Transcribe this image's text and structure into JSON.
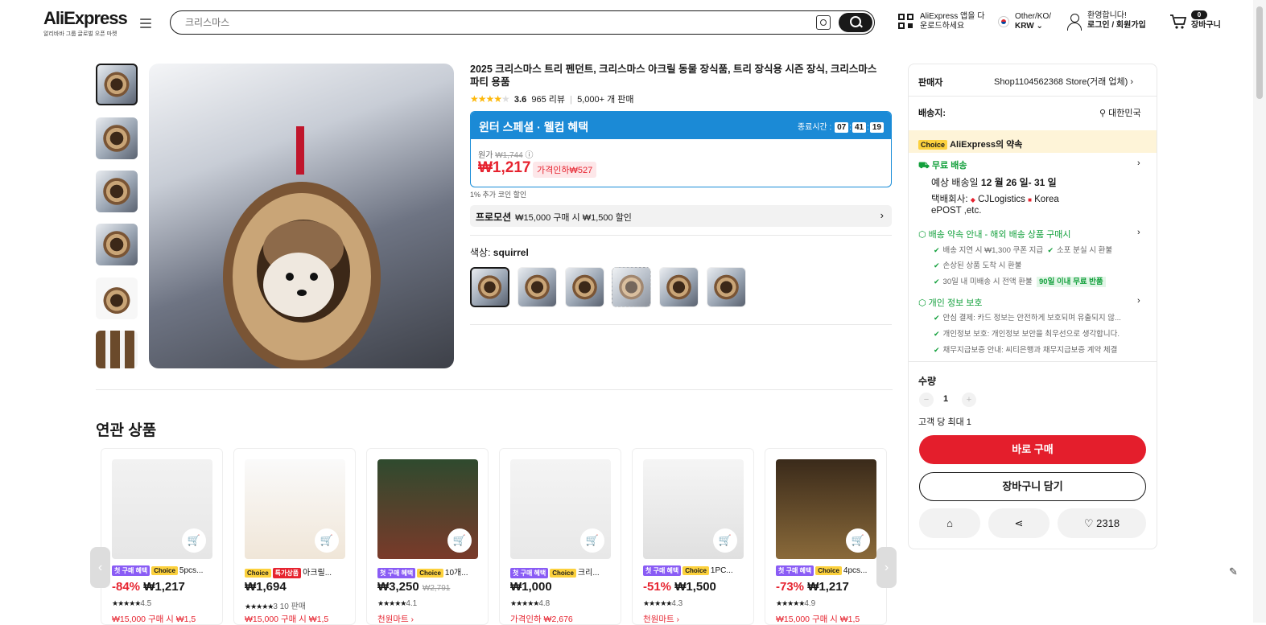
{
  "header": {
    "logo": "AliExpress",
    "logo_sub": "알리바바 그룹 글로벌 오픈 마켓",
    "search_placeholder": "크리스마스",
    "app_download": [
      "AliExpress 앱을 다",
      "운로드하세요"
    ],
    "region_top": "Other/KO/",
    "region_currency": "KRW",
    "welcome": "환영합니다!",
    "login": "로그인 / 회원가입",
    "cart_count": "0",
    "cart_label": "장바구니"
  },
  "product": {
    "title": "2025 크리스마스 트리 펜던트, 크리스마스 아크릴 동물 장식품, 트리 장식용 시즌 장식, 크리스마스 파티 용품",
    "rating": "3.6",
    "reviews": "965 리뷰",
    "sold": "5,000+ 개 판매",
    "promo_title": "윈터 스페셜 · 웰컴 혜택",
    "timer_label": "종료시간 :",
    "timer": [
      "07",
      "41",
      "19"
    ],
    "original_label": "원가",
    "original_price": "₩1,744",
    "price": "₩1,217",
    "discount": "가격인하₩527",
    "coin_note": "1% 추가 코인 할인",
    "promotion_label": "프로모션",
    "promotion_text": "₩15,000 구매 시 ₩1,500 할인",
    "color_label": "색상:",
    "color_value": "squirrel"
  },
  "seller": {
    "seller_label": "판매자",
    "seller_name": "Shop1104562368 Store(거래 업체)",
    "ship_label": "배송지:",
    "ship_to": "대한민국",
    "choice_tag": "Choice",
    "choice_promise": "AliExpress의 약속",
    "free_ship": "무료 배송",
    "eta_label": "예상 배송일",
    "eta": "12 월 26 일- 31 일",
    "courier_label": "택배회사:",
    "courier_1": "CJLogistics",
    "courier_2": "Korea",
    "courier_3": "ePOST ,etc.",
    "promise_title": "배송 약속 안내 - 해외 배송 상품 구매시",
    "promise_items": [
      "배송 지연 시 ₩1,300 쿠폰 지급",
      "소포 분실 시 환불",
      "손상된 상품 도착 시 환불",
      "30일 내 미배송 시 전액 환불"
    ],
    "promise_badge": "90일 이내 무료 반품",
    "privacy_title": "개인 정보 보호",
    "privacy_items": [
      "안심 결제: 카드 정보는 안전하게 보호되며 유출되지 않...",
      "개인정보 보호: 개인정보 보안을 최우선으로 생각합니다.",
      "채무지급보증 안내: 씨티은행과 채무지급보증 계약 체결"
    ],
    "qty_label": "수량",
    "qty": "1",
    "limit": "고객 당 최대 1",
    "buy_now": "바로 구매",
    "add_cart": "장바구니 담기",
    "wishlist_count": "2318"
  },
  "related": {
    "heading": "연관 상품",
    "items": [
      {
        "tags": [
          "첫 구매 혜택",
          "Choice"
        ],
        "name": "5pcs...",
        "pct": "-84%",
        "price": "₩1,217",
        "old": "",
        "rating": "4.5",
        "sold": "",
        "extra": "₩15,000 구매 시 ₩1,5"
      },
      {
        "tags": [
          "Choice",
          "특가상품"
        ],
        "name": "아크릴...",
        "pct": "",
        "price": "₩1,694",
        "old": "",
        "rating": "3",
        "sold": "10 판매",
        "extra": "₩15,000 구매 시 ₩1,5"
      },
      {
        "tags": [
          "첫 구매 혜택",
          "Choice"
        ],
        "name": "10개...",
        "pct": "",
        "price": "₩3,250",
        "old": "₩2,791",
        "rating": "4.1",
        "sold": "",
        "extra": "천원마트 ›"
      },
      {
        "tags": [
          "첫 구매 혜택",
          "Choice"
        ],
        "name": "크리...",
        "pct": "",
        "price": "₩1,000",
        "old": "",
        "rating": "4.8",
        "sold": "",
        "extra": "가격인하 ₩2,676"
      },
      {
        "tags": [
          "첫 구매 혜택",
          "Choice"
        ],
        "name": "1PC...",
        "pct": "-51%",
        "price": "₩1,500",
        "old": "",
        "rating": "4.3",
        "sold": "",
        "extra": "천원마트 ›"
      },
      {
        "tags": [
          "첫 구매 혜택",
          "Choice"
        ],
        "name": "4pcs...",
        "pct": "-73%",
        "price": "₩1,217",
        "old": "",
        "rating": "4.9",
        "sold": "",
        "extra": "₩15,000 구매 시 ₩1,5"
      }
    ]
  }
}
